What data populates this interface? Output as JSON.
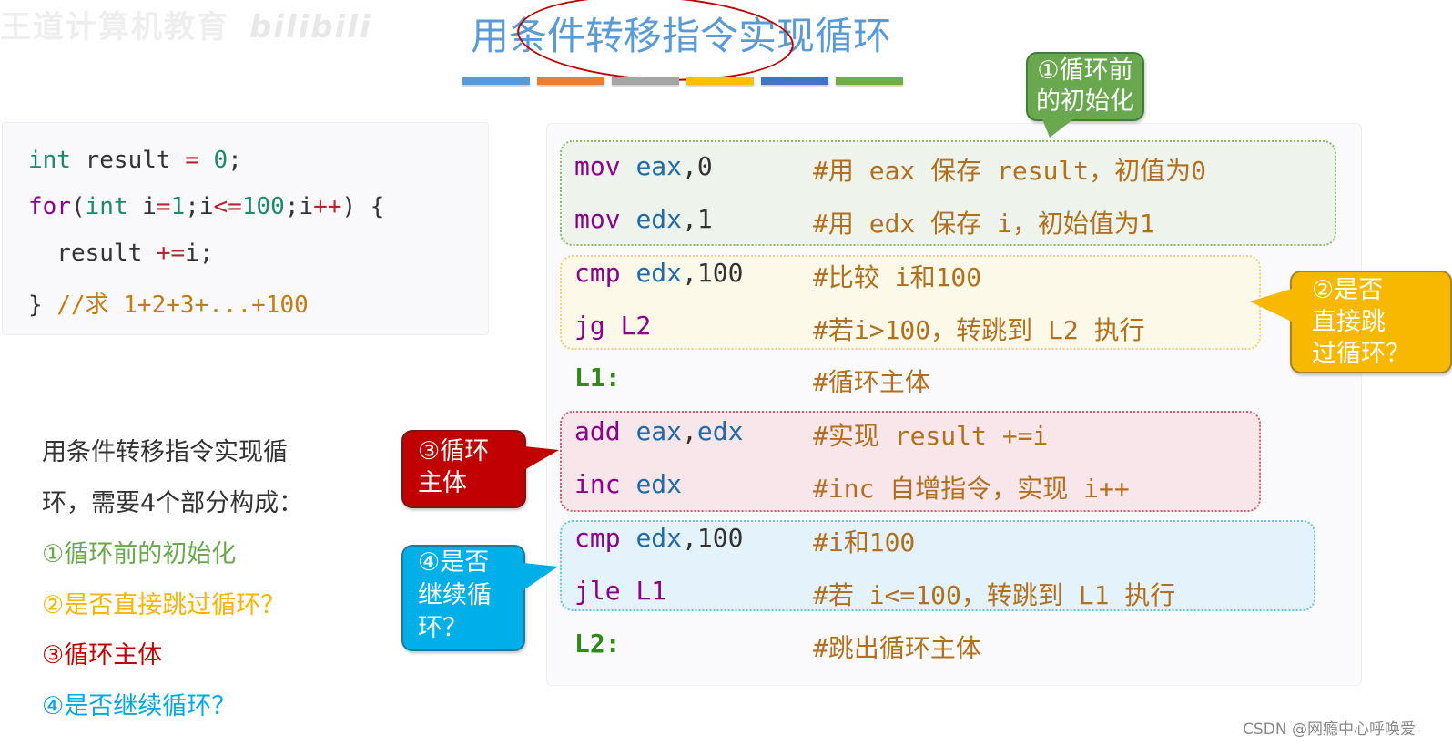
{
  "watermark": {
    "text": "王道计算机教育",
    "brand": "bilibili"
  },
  "slide": {
    "title": "用条件转移指令实现循环",
    "title_bar_colors": [
      "#5b9bd5",
      "#ed7d31",
      "#a5a5a5",
      "#ffc000",
      "#4472c4",
      "#70ad47"
    ]
  },
  "c_code": {
    "lines": [
      {
        "parts": [
          [
            "kw-green",
            "int"
          ],
          [
            "",
            " result "
          ],
          [
            "op-red",
            "="
          ],
          [
            "",
            " "
          ],
          [
            "num-green",
            "0"
          ],
          [
            "",
            ";"
          ]
        ]
      },
      {
        "parts": [
          [
            "kw-purple",
            "for"
          ],
          [
            "",
            "("
          ],
          [
            "kw-green",
            "int"
          ],
          [
            "",
            " i"
          ],
          [
            "op-red",
            "="
          ],
          [
            "num-green",
            "1"
          ],
          [
            "",
            ";i"
          ],
          [
            "op-red",
            "<="
          ],
          [
            "num-green",
            "100"
          ],
          [
            "",
            ";i"
          ],
          [
            "op-red",
            "++"
          ],
          [
            "",
            ") {"
          ]
        ]
      },
      {
        "parts": [
          [
            "",
            "  result "
          ],
          [
            "op-red",
            "+="
          ],
          [
            "",
            "i;"
          ]
        ]
      },
      {
        "parts": [
          [
            "",
            "} "
          ],
          [
            "cmt",
            "//求 1+2+3+...+100"
          ]
        ]
      }
    ]
  },
  "asm": {
    "lines": [
      {
        "group": "init",
        "instr": [
          [
            "op",
            "mov"
          ],
          [
            "",
            " "
          ],
          [
            "reg",
            "eax"
          ],
          [
            "imm",
            ",0"
          ]
        ],
        "comment": "#用 eax 保存 result，初值为0"
      },
      {
        "group": "init",
        "instr": [
          [
            "op",
            "mov"
          ],
          [
            "",
            " "
          ],
          [
            "reg",
            "edx"
          ],
          [
            "imm",
            ",1"
          ]
        ],
        "comment": "#用 edx 保存 i，初始值为1"
      },
      {
        "group": "check",
        "instr": [
          [
            "op",
            "cmp"
          ],
          [
            "",
            " "
          ],
          [
            "reg",
            "edx"
          ],
          [
            "imm",
            ",100"
          ]
        ],
        "comment": "#比较 i和100"
      },
      {
        "group": "check",
        "instr": [
          [
            "op",
            "jg"
          ],
          [
            "",
            " "
          ],
          [
            "lbl-target",
            "L2"
          ]
        ],
        "comment": "#若i>100，转跳到 L2 执行"
      },
      {
        "group": "",
        "instr": [
          [
            "label",
            "L1:"
          ]
        ],
        "comment": "#循环主体"
      },
      {
        "group": "body",
        "instr": [
          [
            "op",
            "add"
          ],
          [
            "",
            " "
          ],
          [
            "reg",
            "eax"
          ],
          [
            "imm",
            ","
          ],
          [
            "reg",
            "edx"
          ]
        ],
        "comment": "#实现 result +=i"
      },
      {
        "group": "body",
        "instr": [
          [
            "op",
            "inc"
          ],
          [
            "",
            " "
          ],
          [
            "reg",
            "edx"
          ]
        ],
        "comment": "#inc 自增指令，实现 i++"
      },
      {
        "group": "cont",
        "instr": [
          [
            "op",
            "cmp"
          ],
          [
            "",
            " "
          ],
          [
            "reg",
            "edx"
          ],
          [
            "imm",
            ",100"
          ]
        ],
        "comment": "#i和100"
      },
      {
        "group": "cont",
        "instr": [
          [
            "op",
            "jle"
          ],
          [
            "",
            " "
          ],
          [
            "lbl-target",
            "L1"
          ]
        ],
        "comment": "#若 i<=100，转跳到 L1 执行"
      },
      {
        "group": "",
        "instr": [
          [
            "label",
            "L2:"
          ]
        ],
        "comment": "#跳出循环主体"
      }
    ]
  },
  "callouts": {
    "c1": [
      "①循环前",
      "的初始化"
    ],
    "c2": [
      "②是否",
      "直接跳",
      "过循环？"
    ],
    "c3": [
      "③循环",
      "主体"
    ],
    "c4": [
      "④是否",
      "继续循",
      "环？"
    ]
  },
  "description": {
    "intro_line1": "用条件转移指令实现循",
    "intro_line2": "环，需要4个部分构成：",
    "steps": [
      "①循环前的初始化",
      "②是否直接跳过循环？",
      "③循环主体",
      "④是否继续循环？"
    ]
  },
  "footer": {
    "credit": "CSDN @网瘾中心呼唤爱"
  }
}
